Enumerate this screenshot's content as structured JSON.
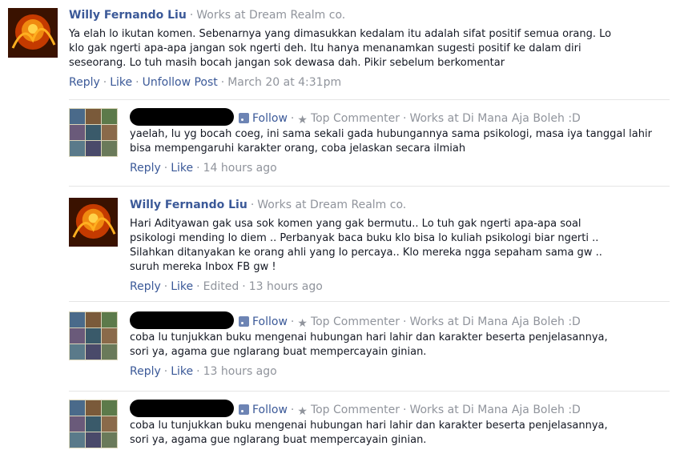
{
  "comments": [
    {
      "author": "Willy Fernando Liu",
      "work": "Works at Dream Realm co.",
      "text": "Ya elah lo ikutan komen. Sebenarnya yang dimasukkan kedalam itu adalah sifat positif semua orang. Lo klo gak ngerti apa-apa jangan sok ngerti deh. Itu hanya menanamkan sugesti positif ke dalam diri seseorang. Lo tuh masih bocah jangan sok dewasa dah. Pikir sebelum berkomentar",
      "reply": "Reply",
      "like": "Like",
      "unfollow": "Unfollow Post",
      "time": "March 20 at 4:31pm"
    },
    {
      "follow": "Follow",
      "top_commenter": "Top Commenter",
      "work": "Works at Di Mana Aja Boleh :D",
      "text": "yaelah, lu yg bocah coeg, ini sama sekali gada hubungannya sama psikologi, masa iya tanggal lahir bisa mempengaruhi karakter orang, coba jelaskan secara ilmiah",
      "reply": "Reply",
      "like": "Like",
      "time": "14 hours ago"
    },
    {
      "author": "Willy Fernando Liu",
      "work": "Works at Dream Realm co.",
      "text": "Hari Adityawan gak usa sok komen yang gak bermutu.. Lo tuh gak ngerti apa-apa soal psikologi mending lo diem .. Perbanyak baca buku klo bisa lo kuliah psikologi biar ngerti .. Silahkan ditanyakan ke orang ahli yang lo percaya.. Klo mereka ngga sepaham sama gw .. suruh mereka Inbox FB gw !",
      "reply": "Reply",
      "like": "Like",
      "edited": "Edited",
      "time": "13 hours ago"
    },
    {
      "follow": "Follow",
      "top_commenter": "Top Commenter",
      "work": "Works at Di Mana Aja Boleh :D",
      "text": "coba lu tunjukkan buku mengenai hubungan hari lahir dan karakter beserta penjelasannya, sori ya, agama gue nglarang buat mempercayain ginian.",
      "reply": "Reply",
      "like": "Like",
      "time": "13 hours ago"
    },
    {
      "follow": "Follow",
      "top_commenter": "Top Commenter",
      "work": "Works at Di Mana Aja Boleh :D",
      "text": "coba lu tunjukkan buku mengenai hubungan hari lahir dan karakter beserta penjelasannya, sori ya, agama gue nglarang buat mempercayain ginian."
    }
  ],
  "colors": {
    "link": "#3b5998",
    "meta": "#90949c",
    "text": "#141823",
    "divider": "#e5e5e5"
  },
  "icons": [
    "rss-icon",
    "star-icon"
  ]
}
